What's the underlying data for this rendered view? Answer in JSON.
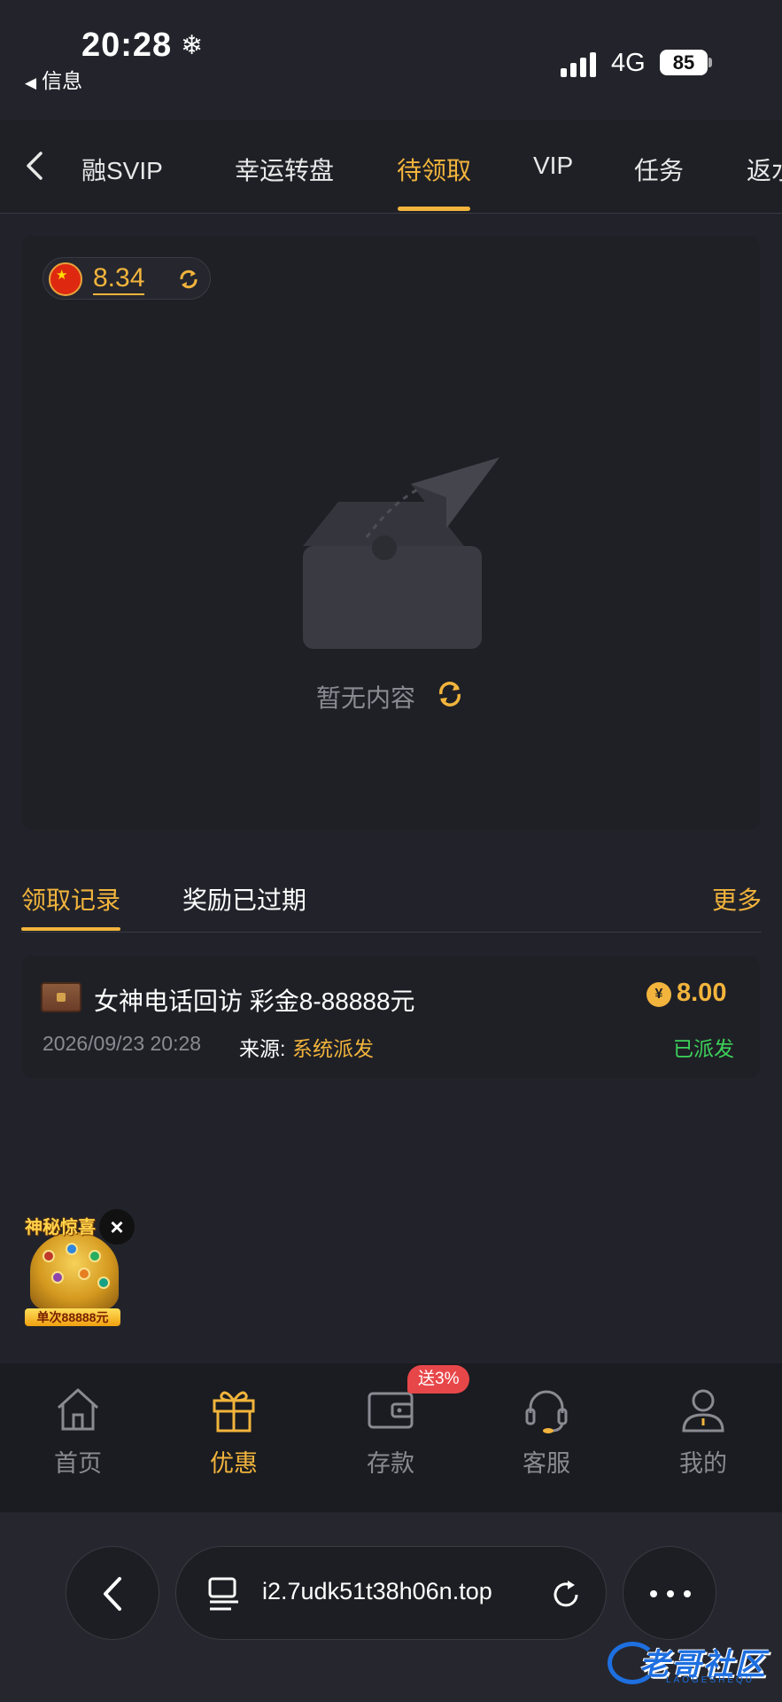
{
  "status_bar": {
    "time": "20:28",
    "weather_icon": "❄",
    "back_app": "信息",
    "network": "4G",
    "battery": "85"
  },
  "tabs": {
    "items": [
      "金融SVIP",
      "幸运转盘",
      "待领取",
      "VIP",
      "任务",
      "返水"
    ],
    "visible_text": [
      "融SVIP",
      "幸运转盘",
      "待领取",
      "VIP",
      "任务",
      "返水"
    ],
    "active_index": 2
  },
  "panel": {
    "balance": "8.34",
    "empty_text": "暂无内容"
  },
  "records": {
    "tabs": [
      "领取记录",
      "奖励已过期"
    ],
    "active_index": 0,
    "more": "更多",
    "items": [
      {
        "title": "女神电话回访 彩金8-88888元",
        "amount_symbol": "¥",
        "amount": "8.00",
        "time": "2026/09/23 20:28",
        "source_label": "来源:",
        "source": "系统派发",
        "status": "已派发"
      }
    ]
  },
  "promo": {
    "title": "神秘惊喜",
    "label": "单次88888元"
  },
  "bottom_nav": {
    "items": [
      {
        "label": "首页",
        "icon": "home-icon"
      },
      {
        "label": "优惠",
        "icon": "gift-icon"
      },
      {
        "label": "存款",
        "icon": "wallet-icon"
      },
      {
        "label": "客服",
        "icon": "headset-icon"
      },
      {
        "label": "我的",
        "icon": "user-icon"
      }
    ],
    "active_index": 1,
    "deposit_badge": "送3%"
  },
  "browser": {
    "url": "i2.7udk51t38h06n.top"
  },
  "watermark": {
    "text": "老哥社区",
    "sub": "LAOGESHEQU"
  },
  "colors": {
    "accent": "#f2b43c",
    "background": "#22232a",
    "card": "#1f2026",
    "success": "#3dd25a",
    "badge": "#e8474a"
  }
}
